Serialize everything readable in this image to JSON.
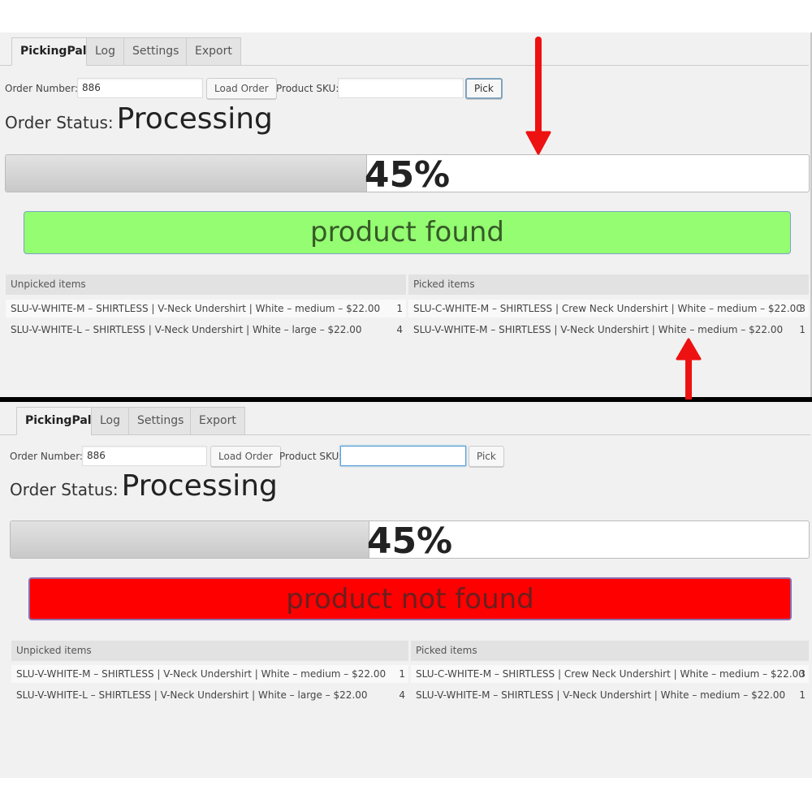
{
  "colors": {
    "found_bg": "#94fd72",
    "not_found_bg": "#ff0000",
    "arrow": "#ee1111",
    "divider": "#000000"
  },
  "screens": [
    {
      "tabs": [
        {
          "label": "PickingPal",
          "active": true
        },
        {
          "label": "Log",
          "active": false
        },
        {
          "label": "Settings",
          "active": false
        },
        {
          "label": "Export",
          "active": false
        }
      ],
      "order_number_label": "Order Number:",
      "order_number_value": "886",
      "load_order_label": "Load Order",
      "product_sku_label": "Product SKU:",
      "product_sku_value": "",
      "pick_label": "Pick",
      "order_status_label": "Order Status:",
      "order_status_value": "Processing",
      "progress_percent": 45,
      "progress_text": "45%",
      "result_message": "product found",
      "result_state": "found",
      "unpicked_header": "Unpicked items",
      "picked_header": "Picked items",
      "unpicked_items": [
        {
          "text": "SLU-V-WHITE-M – SHIRTLESS | V-Neck Undershirt | White – medium – $22.00",
          "qty": "1"
        },
        {
          "text": "SLU-V-WHITE-L – SHIRTLESS | V-Neck Undershirt | White – large – $22.00",
          "qty": "4"
        }
      ],
      "picked_items": [
        {
          "text": "SLU-C-WHITE-M – SHIRTLESS | Crew Neck Undershirt | White – medium – $22.00",
          "qty": "3"
        },
        {
          "text": "SLU-V-WHITE-M – SHIRTLESS | V-Neck Undershirt | White – medium – $22.00",
          "qty": "1"
        }
      ],
      "annotation_arrows": [
        "arrow-down-to-progress",
        "arrow-up-to-picked-item"
      ]
    },
    {
      "tabs": [
        {
          "label": "PickingPal",
          "active": true
        },
        {
          "label": "Log",
          "active": false
        },
        {
          "label": "Settings",
          "active": false
        },
        {
          "label": "Export",
          "active": false
        }
      ],
      "order_number_label": "Order Number:",
      "order_number_value": "886",
      "load_order_label": "Load Order",
      "product_sku_label": "Product SKU:",
      "product_sku_value": "",
      "pick_label": "Pick",
      "order_status_label": "Order Status:",
      "order_status_value": "Processing",
      "progress_percent": 45,
      "progress_text": "45%",
      "result_message": "product not found",
      "result_state": "not_found",
      "unpicked_header": "Unpicked items",
      "picked_header": "Picked items",
      "unpicked_items": [
        {
          "text": "SLU-V-WHITE-M – SHIRTLESS | V-Neck Undershirt | White – medium – $22.00",
          "qty": "1"
        },
        {
          "text": "SLU-V-WHITE-L – SHIRTLESS | V-Neck Undershirt | White – large – $22.00",
          "qty": "4"
        }
      ],
      "picked_items": [
        {
          "text": "SLU-C-WHITE-M – SHIRTLESS | Crew Neck Undershirt | White – medium – $22.00",
          "qty": "3"
        },
        {
          "text": "SLU-V-WHITE-M – SHIRTLESS | V-Neck Undershirt | White – medium – $22.00",
          "qty": "1"
        }
      ]
    }
  ]
}
